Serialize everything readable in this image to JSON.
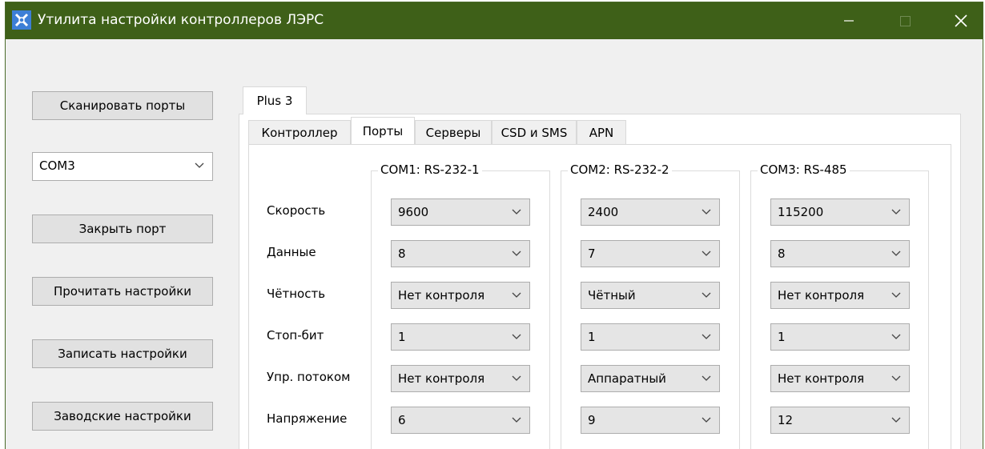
{
  "window": {
    "title": "Утилита настройки контроллеров ЛЭРС",
    "icon": "app-icon",
    "colors": {
      "titlebar": "#3e6018",
      "face": "#f0f0f0"
    }
  },
  "left_panel": {
    "scan_label": "Сканировать порты",
    "port_select_value": "COM3",
    "close_port_label": "Закрыть порт",
    "read_label": "Прочитать настройки",
    "write_label": "Записать настройки",
    "factory_label": "Заводские настройки"
  },
  "device_tab": {
    "label": "Plus 3"
  },
  "tabs": [
    {
      "label": "Контроллер",
      "active": false
    },
    {
      "label": "Порты",
      "active": true
    },
    {
      "label": "Серверы",
      "active": false
    },
    {
      "label": "CSD и SMS",
      "active": false
    },
    {
      "label": "APN",
      "active": false
    }
  ],
  "ports": {
    "row_labels": [
      "Скорость",
      "Данные",
      "Чётность",
      "Стоп-бит",
      "Упр. потоком",
      "Напряжение"
    ],
    "groups": [
      {
        "title": "COM1: RS-232-1",
        "values": [
          "9600",
          "8",
          "Нет контроля",
          "1",
          "Нет контроля",
          "6"
        ]
      },
      {
        "title": "COM2: RS-232-2",
        "values": [
          "2400",
          "7",
          "Чётный",
          "1",
          "Аппаратный",
          "9"
        ]
      },
      {
        "title": "COM3: RS-485",
        "values": [
          "115200",
          "8",
          "Нет контроля",
          "1",
          "Нет контроля",
          "12"
        ]
      }
    ]
  }
}
